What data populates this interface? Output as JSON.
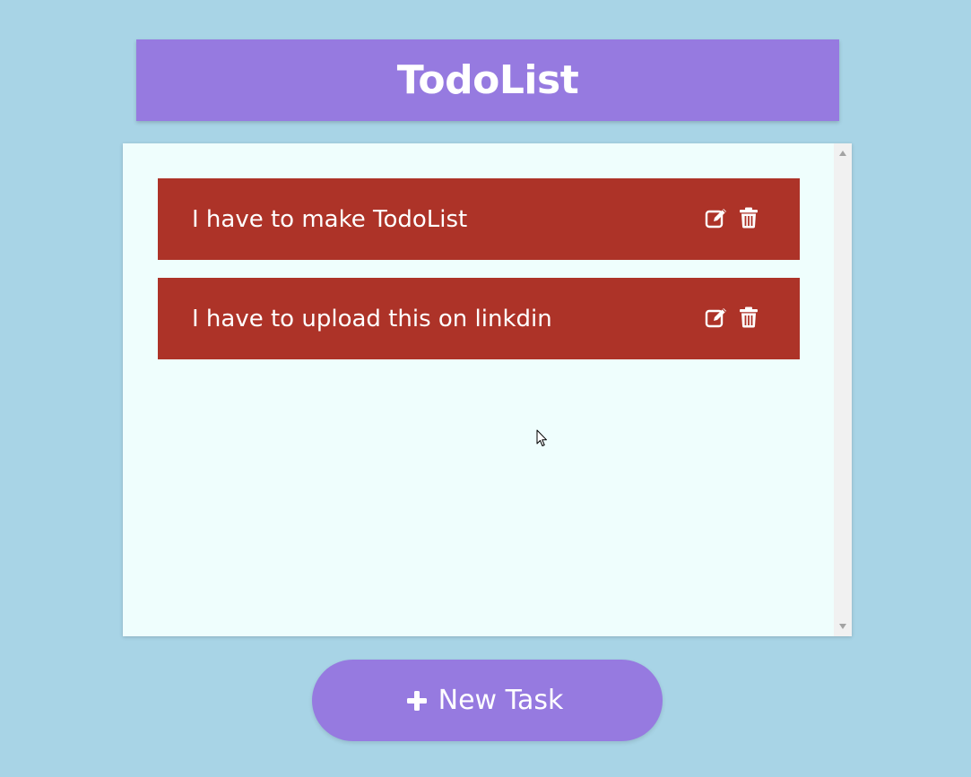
{
  "header": {
    "title": "TodoList"
  },
  "tasks": [
    {
      "text": "I have to make TodoList",
      "edit_icon": "edit-icon",
      "delete_icon": "trash-icon"
    },
    {
      "text": "I have to upload this on linkdin",
      "edit_icon": "edit-icon",
      "delete_icon": "trash-icon"
    }
  ],
  "new_task_button": {
    "icon": "plus-icon",
    "label": "New Task"
  },
  "colors": {
    "background": "#a8d4e6",
    "accent": "#967ae0",
    "task": "#ad3328",
    "panel": "#effefd"
  }
}
